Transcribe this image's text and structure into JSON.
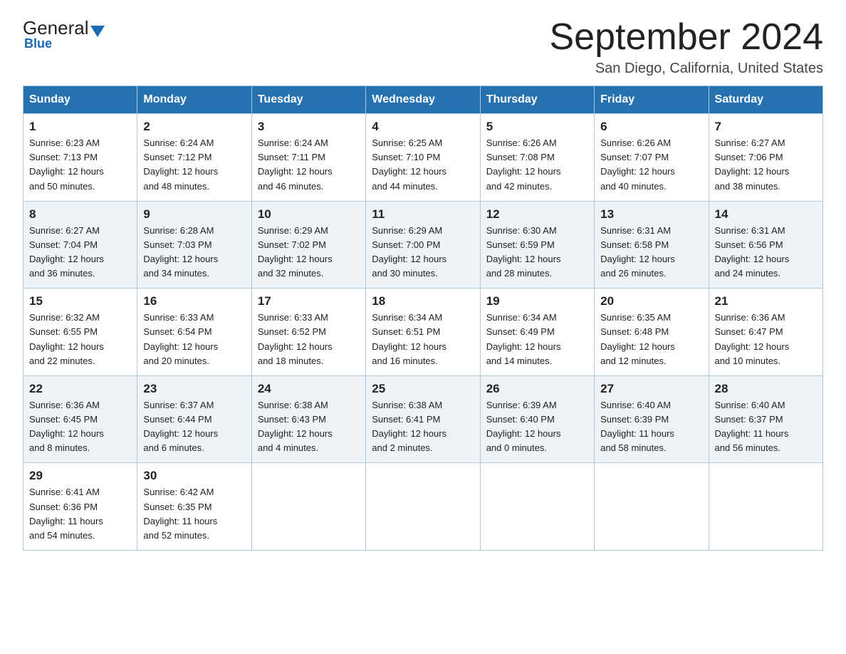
{
  "logo": {
    "general": "General",
    "blue": "Blue",
    "subtitle": "Blue"
  },
  "header": {
    "title": "September 2024",
    "subtitle": "San Diego, California, United States"
  },
  "days_of_week": [
    "Sunday",
    "Monday",
    "Tuesday",
    "Wednesday",
    "Thursday",
    "Friday",
    "Saturday"
  ],
  "weeks": [
    [
      {
        "day": "1",
        "sunrise": "6:23 AM",
        "sunset": "7:13 PM",
        "daylight": "12 hours and 50 minutes."
      },
      {
        "day": "2",
        "sunrise": "6:24 AM",
        "sunset": "7:12 PM",
        "daylight": "12 hours and 48 minutes."
      },
      {
        "day": "3",
        "sunrise": "6:24 AM",
        "sunset": "7:11 PM",
        "daylight": "12 hours and 46 minutes."
      },
      {
        "day": "4",
        "sunrise": "6:25 AM",
        "sunset": "7:10 PM",
        "daylight": "12 hours and 44 minutes."
      },
      {
        "day": "5",
        "sunrise": "6:26 AM",
        "sunset": "7:08 PM",
        "daylight": "12 hours and 42 minutes."
      },
      {
        "day": "6",
        "sunrise": "6:26 AM",
        "sunset": "7:07 PM",
        "daylight": "12 hours and 40 minutes."
      },
      {
        "day": "7",
        "sunrise": "6:27 AM",
        "sunset": "7:06 PM",
        "daylight": "12 hours and 38 minutes."
      }
    ],
    [
      {
        "day": "8",
        "sunrise": "6:27 AM",
        "sunset": "7:04 PM",
        "daylight": "12 hours and 36 minutes."
      },
      {
        "day": "9",
        "sunrise": "6:28 AM",
        "sunset": "7:03 PM",
        "daylight": "12 hours and 34 minutes."
      },
      {
        "day": "10",
        "sunrise": "6:29 AM",
        "sunset": "7:02 PM",
        "daylight": "12 hours and 32 minutes."
      },
      {
        "day": "11",
        "sunrise": "6:29 AM",
        "sunset": "7:00 PM",
        "daylight": "12 hours and 30 minutes."
      },
      {
        "day": "12",
        "sunrise": "6:30 AM",
        "sunset": "6:59 PM",
        "daylight": "12 hours and 28 minutes."
      },
      {
        "day": "13",
        "sunrise": "6:31 AM",
        "sunset": "6:58 PM",
        "daylight": "12 hours and 26 minutes."
      },
      {
        "day": "14",
        "sunrise": "6:31 AM",
        "sunset": "6:56 PM",
        "daylight": "12 hours and 24 minutes."
      }
    ],
    [
      {
        "day": "15",
        "sunrise": "6:32 AM",
        "sunset": "6:55 PM",
        "daylight": "12 hours and 22 minutes."
      },
      {
        "day": "16",
        "sunrise": "6:33 AM",
        "sunset": "6:54 PM",
        "daylight": "12 hours and 20 minutes."
      },
      {
        "day": "17",
        "sunrise": "6:33 AM",
        "sunset": "6:52 PM",
        "daylight": "12 hours and 18 minutes."
      },
      {
        "day": "18",
        "sunrise": "6:34 AM",
        "sunset": "6:51 PM",
        "daylight": "12 hours and 16 minutes."
      },
      {
        "day": "19",
        "sunrise": "6:34 AM",
        "sunset": "6:49 PM",
        "daylight": "12 hours and 14 minutes."
      },
      {
        "day": "20",
        "sunrise": "6:35 AM",
        "sunset": "6:48 PM",
        "daylight": "12 hours and 12 minutes."
      },
      {
        "day": "21",
        "sunrise": "6:36 AM",
        "sunset": "6:47 PM",
        "daylight": "12 hours and 10 minutes."
      }
    ],
    [
      {
        "day": "22",
        "sunrise": "6:36 AM",
        "sunset": "6:45 PM",
        "daylight": "12 hours and 8 minutes."
      },
      {
        "day": "23",
        "sunrise": "6:37 AM",
        "sunset": "6:44 PM",
        "daylight": "12 hours and 6 minutes."
      },
      {
        "day": "24",
        "sunrise": "6:38 AM",
        "sunset": "6:43 PM",
        "daylight": "12 hours and 4 minutes."
      },
      {
        "day": "25",
        "sunrise": "6:38 AM",
        "sunset": "6:41 PM",
        "daylight": "12 hours and 2 minutes."
      },
      {
        "day": "26",
        "sunrise": "6:39 AM",
        "sunset": "6:40 PM",
        "daylight": "12 hours and 0 minutes."
      },
      {
        "day": "27",
        "sunrise": "6:40 AM",
        "sunset": "6:39 PM",
        "daylight": "11 hours and 58 minutes."
      },
      {
        "day": "28",
        "sunrise": "6:40 AM",
        "sunset": "6:37 PM",
        "daylight": "11 hours and 56 minutes."
      }
    ],
    [
      {
        "day": "29",
        "sunrise": "6:41 AM",
        "sunset": "6:36 PM",
        "daylight": "11 hours and 54 minutes."
      },
      {
        "day": "30",
        "sunrise": "6:42 AM",
        "sunset": "6:35 PM",
        "daylight": "11 hours and 52 minutes."
      },
      null,
      null,
      null,
      null,
      null
    ]
  ],
  "labels": {
    "sunrise": "Sunrise:",
    "sunset": "Sunset:",
    "daylight": "Daylight:"
  }
}
